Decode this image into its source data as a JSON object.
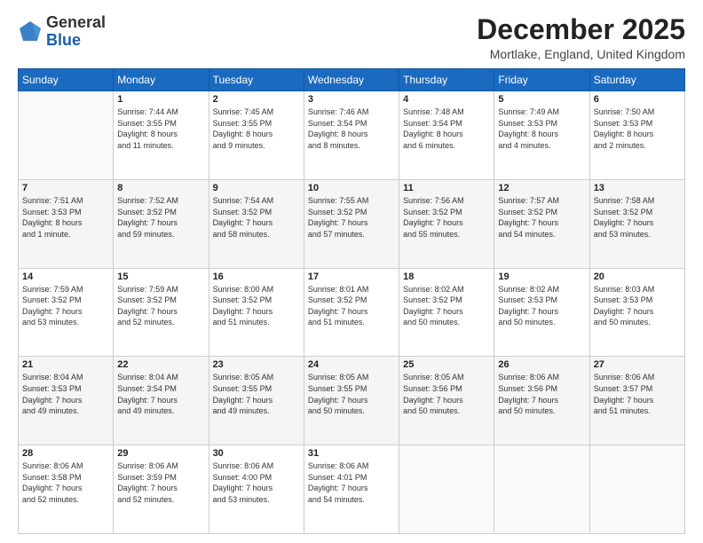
{
  "logo": {
    "general": "General",
    "blue": "Blue"
  },
  "header": {
    "month": "December 2025",
    "location": "Mortlake, England, United Kingdom"
  },
  "weekdays": [
    "Sunday",
    "Monday",
    "Tuesday",
    "Wednesday",
    "Thursday",
    "Friday",
    "Saturday"
  ],
  "weeks": [
    [
      {
        "day": "",
        "info": ""
      },
      {
        "day": "1",
        "info": "Sunrise: 7:44 AM\nSunset: 3:55 PM\nDaylight: 8 hours\nand 11 minutes."
      },
      {
        "day": "2",
        "info": "Sunrise: 7:45 AM\nSunset: 3:55 PM\nDaylight: 8 hours\nand 9 minutes."
      },
      {
        "day": "3",
        "info": "Sunrise: 7:46 AM\nSunset: 3:54 PM\nDaylight: 8 hours\nand 8 minutes."
      },
      {
        "day": "4",
        "info": "Sunrise: 7:48 AM\nSunset: 3:54 PM\nDaylight: 8 hours\nand 6 minutes."
      },
      {
        "day": "5",
        "info": "Sunrise: 7:49 AM\nSunset: 3:53 PM\nDaylight: 8 hours\nand 4 minutes."
      },
      {
        "day": "6",
        "info": "Sunrise: 7:50 AM\nSunset: 3:53 PM\nDaylight: 8 hours\nand 2 minutes."
      }
    ],
    [
      {
        "day": "7",
        "info": "Sunrise: 7:51 AM\nSunset: 3:53 PM\nDaylight: 8 hours\nand 1 minute."
      },
      {
        "day": "8",
        "info": "Sunrise: 7:52 AM\nSunset: 3:52 PM\nDaylight: 7 hours\nand 59 minutes."
      },
      {
        "day": "9",
        "info": "Sunrise: 7:54 AM\nSunset: 3:52 PM\nDaylight: 7 hours\nand 58 minutes."
      },
      {
        "day": "10",
        "info": "Sunrise: 7:55 AM\nSunset: 3:52 PM\nDaylight: 7 hours\nand 57 minutes."
      },
      {
        "day": "11",
        "info": "Sunrise: 7:56 AM\nSunset: 3:52 PM\nDaylight: 7 hours\nand 55 minutes."
      },
      {
        "day": "12",
        "info": "Sunrise: 7:57 AM\nSunset: 3:52 PM\nDaylight: 7 hours\nand 54 minutes."
      },
      {
        "day": "13",
        "info": "Sunrise: 7:58 AM\nSunset: 3:52 PM\nDaylight: 7 hours\nand 53 minutes."
      }
    ],
    [
      {
        "day": "14",
        "info": "Sunrise: 7:59 AM\nSunset: 3:52 PM\nDaylight: 7 hours\nand 53 minutes."
      },
      {
        "day": "15",
        "info": "Sunrise: 7:59 AM\nSunset: 3:52 PM\nDaylight: 7 hours\nand 52 minutes."
      },
      {
        "day": "16",
        "info": "Sunrise: 8:00 AM\nSunset: 3:52 PM\nDaylight: 7 hours\nand 51 minutes."
      },
      {
        "day": "17",
        "info": "Sunrise: 8:01 AM\nSunset: 3:52 PM\nDaylight: 7 hours\nand 51 minutes."
      },
      {
        "day": "18",
        "info": "Sunrise: 8:02 AM\nSunset: 3:52 PM\nDaylight: 7 hours\nand 50 minutes."
      },
      {
        "day": "19",
        "info": "Sunrise: 8:02 AM\nSunset: 3:53 PM\nDaylight: 7 hours\nand 50 minutes."
      },
      {
        "day": "20",
        "info": "Sunrise: 8:03 AM\nSunset: 3:53 PM\nDaylight: 7 hours\nand 50 minutes."
      }
    ],
    [
      {
        "day": "21",
        "info": "Sunrise: 8:04 AM\nSunset: 3:53 PM\nDaylight: 7 hours\nand 49 minutes."
      },
      {
        "day": "22",
        "info": "Sunrise: 8:04 AM\nSunset: 3:54 PM\nDaylight: 7 hours\nand 49 minutes."
      },
      {
        "day": "23",
        "info": "Sunrise: 8:05 AM\nSunset: 3:55 PM\nDaylight: 7 hours\nand 49 minutes."
      },
      {
        "day": "24",
        "info": "Sunrise: 8:05 AM\nSunset: 3:55 PM\nDaylight: 7 hours\nand 50 minutes."
      },
      {
        "day": "25",
        "info": "Sunrise: 8:05 AM\nSunset: 3:56 PM\nDaylight: 7 hours\nand 50 minutes."
      },
      {
        "day": "26",
        "info": "Sunrise: 8:06 AM\nSunset: 3:56 PM\nDaylight: 7 hours\nand 50 minutes."
      },
      {
        "day": "27",
        "info": "Sunrise: 8:06 AM\nSunset: 3:57 PM\nDaylight: 7 hours\nand 51 minutes."
      }
    ],
    [
      {
        "day": "28",
        "info": "Sunrise: 8:06 AM\nSunset: 3:58 PM\nDaylight: 7 hours\nand 52 minutes."
      },
      {
        "day": "29",
        "info": "Sunrise: 8:06 AM\nSunset: 3:59 PM\nDaylight: 7 hours\nand 52 minutes."
      },
      {
        "day": "30",
        "info": "Sunrise: 8:06 AM\nSunset: 4:00 PM\nDaylight: 7 hours\nand 53 minutes."
      },
      {
        "day": "31",
        "info": "Sunrise: 8:06 AM\nSunset: 4:01 PM\nDaylight: 7 hours\nand 54 minutes."
      },
      {
        "day": "",
        "info": ""
      },
      {
        "day": "",
        "info": ""
      },
      {
        "day": "",
        "info": ""
      }
    ]
  ]
}
